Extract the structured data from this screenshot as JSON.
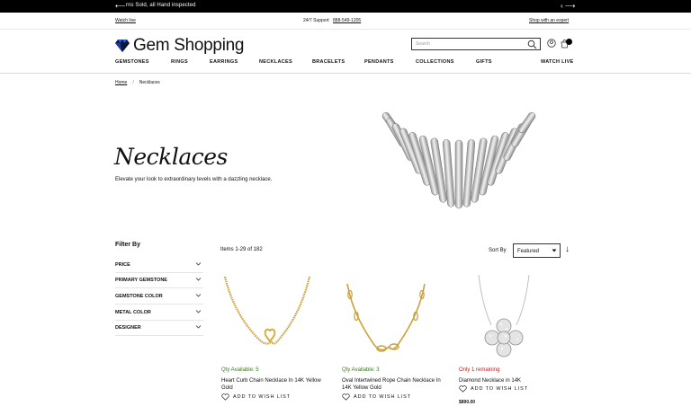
{
  "topbar": {
    "message": "rns Sold, all Hand inspected",
    "left_arrow": "⟵",
    "right_arrows": "‹ ⟶"
  },
  "utility": {
    "watch_live": "Watch live",
    "support_label": "24/7 Support",
    "support_number": "888-549-1205",
    "expert": "Shop with an expert"
  },
  "header": {
    "logo_text": "Gem Shopping",
    "search_placeholder": "Search"
  },
  "nav": [
    "GEMSTONES",
    "RINGS",
    "EARRINGS",
    "NECKLACES",
    "BRACELETS",
    "PENDANTS",
    "COLLECTIONS",
    "GIFTS",
    "WATCH LIVE"
  ],
  "breadcrumb": {
    "home": "Home",
    "separator": "/",
    "current": "Necklaces"
  },
  "hero": {
    "title": "Necklaces",
    "subtitle": "Elevate your look to extraordinary levels with a dazzling necklace."
  },
  "filters": {
    "title": "Filter By",
    "items": [
      "PRICE",
      "PRIMARY GEMSTONE",
      "GEMSTONE COLOR",
      "METAL COLOR",
      "DESIGNER"
    ]
  },
  "listing": {
    "count": "Items 1-29 of 182",
    "sort_label": "Sort By",
    "sort_value": "Featured",
    "sort_direction": "↓"
  },
  "products": [
    {
      "availability": "Qty Available: 5",
      "availability_color": "#3d7a1e",
      "title": "Heart Curb Chain Necklace In 14K Yellow Gold",
      "wish": "ADD TO WISH LIST",
      "price": ""
    },
    {
      "availability": "Qty Available: 3",
      "availability_color": "#3d7a1e",
      "title": "Oval Intertwined Rope Chain Necklace In 14K Yellow Gold",
      "wish": "ADD TO WISH LIST",
      "price": ""
    },
    {
      "availability": "Only 1 remaining",
      "availability_color": "#c81e1e",
      "title": "Diamond Necklace in 14K",
      "wish": "ADD TO WISH LIST",
      "price": "$890.00"
    }
  ]
}
